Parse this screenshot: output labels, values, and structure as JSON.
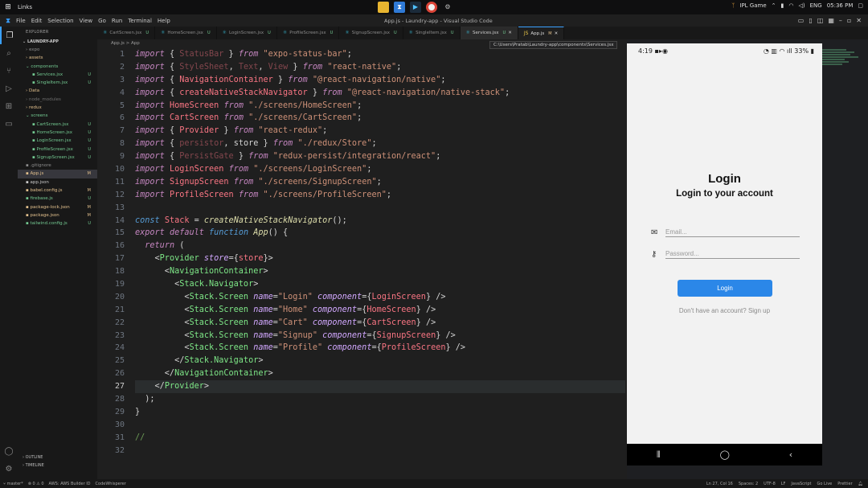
{
  "taskbar": {
    "title": "Links",
    "right": {
      "game": "IPL Game",
      "lang": "ENG",
      "time": "05:36 PM"
    }
  },
  "menubar": {
    "items": [
      "File",
      "Edit",
      "Selection",
      "View",
      "Go",
      "Run",
      "Terminal",
      "Help"
    ],
    "window_title": "App.js - Laundry-app - Visual Studio Code"
  },
  "sidebar": {
    "header": "EXPLORER",
    "project": "LAUNDRY-APP",
    "items": [
      {
        "label": "expo",
        "indent": 1,
        "kind": "folder",
        "git": "",
        "color": "#8c8c8c"
      },
      {
        "label": "assets",
        "indent": 1,
        "kind": "folder",
        "git": "",
        "color": "#e2c08d"
      },
      {
        "label": "components",
        "indent": 1,
        "kind": "folder-open",
        "git": "",
        "color": "#73c991"
      },
      {
        "label": "Services.jsx",
        "indent": 2,
        "kind": "file",
        "git": "U",
        "color": "#73c991"
      },
      {
        "label": "SingleItem.jsx",
        "indent": 2,
        "kind": "file",
        "git": "U",
        "color": "#73c991"
      },
      {
        "label": "Data",
        "indent": 1,
        "kind": "folder",
        "git": "",
        "color": "#e2c08d"
      },
      {
        "label": "node_modules",
        "indent": 1,
        "kind": "folder",
        "git": "",
        "color": "#6e6e6e"
      },
      {
        "label": "redux",
        "indent": 1,
        "kind": "folder",
        "git": "",
        "color": "#e2c08d"
      },
      {
        "label": "screens",
        "indent": 1,
        "kind": "folder-open",
        "git": "",
        "color": "#73c991"
      },
      {
        "label": "CartScreen.jsx",
        "indent": 2,
        "kind": "file",
        "git": "U",
        "color": "#73c991"
      },
      {
        "label": "HomeScreen.jsx",
        "indent": 2,
        "kind": "file",
        "git": "U",
        "color": "#73c991"
      },
      {
        "label": "LoginScreen.jsx",
        "indent": 2,
        "kind": "file",
        "git": "U",
        "color": "#73c991"
      },
      {
        "label": "ProfileScreen.jsx",
        "indent": 2,
        "kind": "file",
        "git": "U",
        "color": "#73c991"
      },
      {
        "label": "SignupScreen.jsx",
        "indent": 2,
        "kind": "file",
        "git": "U",
        "color": "#73c991"
      },
      {
        "label": ".gitignore",
        "indent": 1,
        "kind": "file",
        "git": "",
        "color": "#8c8c8c"
      },
      {
        "label": "App.js",
        "indent": 1,
        "kind": "file",
        "git": "M",
        "color": "#e2c08d",
        "active": true
      },
      {
        "label": "app.json",
        "indent": 1,
        "kind": "file",
        "git": "",
        "color": "#cccccc"
      },
      {
        "label": "babel.config.js",
        "indent": 1,
        "kind": "file",
        "git": "M",
        "color": "#e2c08d"
      },
      {
        "label": "firebase.js",
        "indent": 1,
        "kind": "file",
        "git": "U",
        "color": "#73c991"
      },
      {
        "label": "package-lock.json",
        "indent": 1,
        "kind": "file",
        "git": "M",
        "color": "#e2c08d"
      },
      {
        "label": "package.json",
        "indent": 1,
        "kind": "file",
        "git": "M",
        "color": "#e2c08d"
      },
      {
        "label": "tailwind.config.js",
        "indent": 1,
        "kind": "file",
        "git": "U",
        "color": "#73c991"
      }
    ],
    "outline": "OUTLINE",
    "timeline": "TIMELINE"
  },
  "tabs": [
    {
      "label": "CartScreen.jsx",
      "status": "U"
    },
    {
      "label": "HomeScreen.jsx",
      "status": "U"
    },
    {
      "label": "LoginScreen.jsx",
      "status": "U"
    },
    {
      "label": "ProfileScreen.jsx",
      "status": "U"
    },
    {
      "label": "SignupScreen.jsx",
      "status": "U"
    },
    {
      "label": "SingleItem.jsx",
      "status": "U"
    },
    {
      "label": "Services.jsx",
      "status": "U",
      "hover": true
    },
    {
      "label": "App.js",
      "status": "M",
      "active": true
    }
  ],
  "breadcrumb": "App.js > App",
  "tooltip": "C:\\Users\\Pratab\\Laundry-app\\components\\Services.jsx",
  "editor": {
    "current_line": 27,
    "lines": [
      "import { StatusBar } from \"expo-status-bar\";",
      "import { StyleSheet, Text, View } from \"react-native\";",
      "import { NavigationContainer } from \"@react-navigation/native\";",
      "import { createNativeStackNavigator } from \"@react-navigation/native-stack\";",
      "import HomeScreen from \"./screens/HomeScreen\";",
      "import CartScreen from \"./screens/CartScreen\";",
      "import { Provider } from \"react-redux\";",
      "import { persistor, store } from \"./redux/Store\";",
      "import { PersistGate } from \"redux-persist/integration/react\";",
      "import LoginScreen from \"./screens/LoginScreen\";",
      "import SignupScreen from \"./screens/SignupScreen\";",
      "import ProfileScreen from \"./screens/ProfileScreen\";",
      "",
      "const Stack = createNativeStackNavigator();",
      "export default function App() {",
      "  return (",
      "    <Provider store={store}>",
      "      <NavigationContainer>",
      "        <Stack.Navigator>",
      "          <Stack.Screen name=\"Login\" component={LoginScreen} />",
      "          <Stack.Screen name=\"Home\" component={HomeScreen} />",
      "          <Stack.Screen name=\"Cart\" component={CartScreen} />",
      "          <Stack.Screen name=\"Signup\" component={SignupScreen} />",
      "          <Stack.Screen name=\"Profile\" component={ProfileScreen} />",
      "        </Stack.Navigator>",
      "      </NavigationContainer>",
      "    </Provider>",
      "  );",
      "}",
      "",
      "//",
      ""
    ]
  },
  "phone": {
    "time": "4:19",
    "battery": "33%",
    "title": "Login",
    "subtitle": "Login to your account",
    "email_placeholder": "Email...",
    "password_placeholder": "Password...",
    "login_label": "Login",
    "signup_text": "Don't have an account? Sign up"
  },
  "statusbar": {
    "branch": "master*",
    "errors": "0 ⚠ 0",
    "aws": "AWS: AWS Builder ID",
    "whisperer": "CodeWhisperer",
    "position": "Ln 27, Col 16",
    "spaces": "Spaces: 2",
    "encoding": "UTF-8",
    "eol": "LF",
    "language": "JavaScript",
    "golive": "Go Live",
    "prettier": "Prettier"
  }
}
